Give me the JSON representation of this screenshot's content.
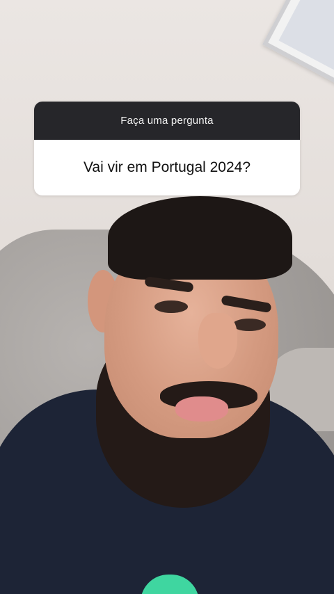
{
  "question_sticker": {
    "header_label": "Faça uma pergunta",
    "question_text": "Vai vir em Portugal 2024?"
  },
  "colors": {
    "sticker_header": "#26262a",
    "sticker_body": "#ffffff",
    "shirt": "#1d2436",
    "badge": "#3fd6a0"
  }
}
